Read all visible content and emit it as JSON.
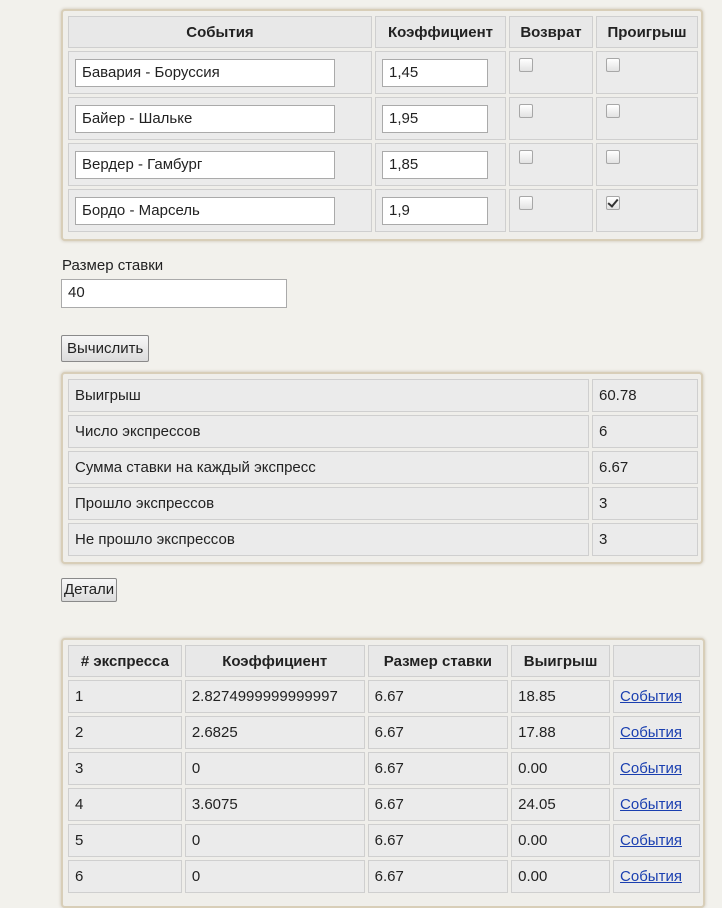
{
  "events_table": {
    "headers": [
      "События",
      "Коэффициент",
      "Возврат",
      "Проигрыш"
    ],
    "rows": [
      {
        "event": "Бавария - Боруссия",
        "coef": "1,45",
        "refund": false,
        "loss": false
      },
      {
        "event": "Байер -  Шальке",
        "coef": "1,95",
        "refund": false,
        "loss": false
      },
      {
        "event": "Вердер  - Гамбург",
        "coef": "1,85",
        "refund": false,
        "loss": false
      },
      {
        "event": "Бордо - Марсель",
        "coef": "1,9",
        "refund": false,
        "loss": true
      }
    ]
  },
  "stake": {
    "label": "Размер ставки",
    "value": "40"
  },
  "calc_button": "Вычислить",
  "results": [
    {
      "label": "Выигрыш",
      "value": "60.78"
    },
    {
      "label": "Число экспрессов",
      "value": "6"
    },
    {
      "label": "Сумма ставки на каждый экспресс",
      "value": "6.67"
    },
    {
      "label": "Прошло экспрессов",
      "value": "3"
    },
    {
      "label": "Не прошло экспрессов",
      "value": "3"
    }
  ],
  "details_button": "Детали",
  "express_table": {
    "headers": [
      "# экспресса",
      "Коэффициент",
      "Размер ставки",
      "Выигрыш",
      ""
    ],
    "rows": [
      {
        "num": "1",
        "coef": "2.8274999999999997",
        "stake": "6.67",
        "win": "18.85",
        "link": "События"
      },
      {
        "num": "2",
        "coef": "2.6825",
        "stake": "6.67",
        "win": "17.88",
        "link": "События"
      },
      {
        "num": "3",
        "coef": "0",
        "stake": "6.67",
        "win": "0.00",
        "link": "События"
      },
      {
        "num": "4",
        "coef": "3.6075",
        "stake": "6.67",
        "win": "24.05",
        "link": "События"
      },
      {
        "num": "5",
        "coef": "0",
        "stake": "6.67",
        "win": "0.00",
        "link": "События"
      },
      {
        "num": "6",
        "coef": "0",
        "stake": "6.67",
        "win": "0.00",
        "link": "События"
      }
    ]
  }
}
